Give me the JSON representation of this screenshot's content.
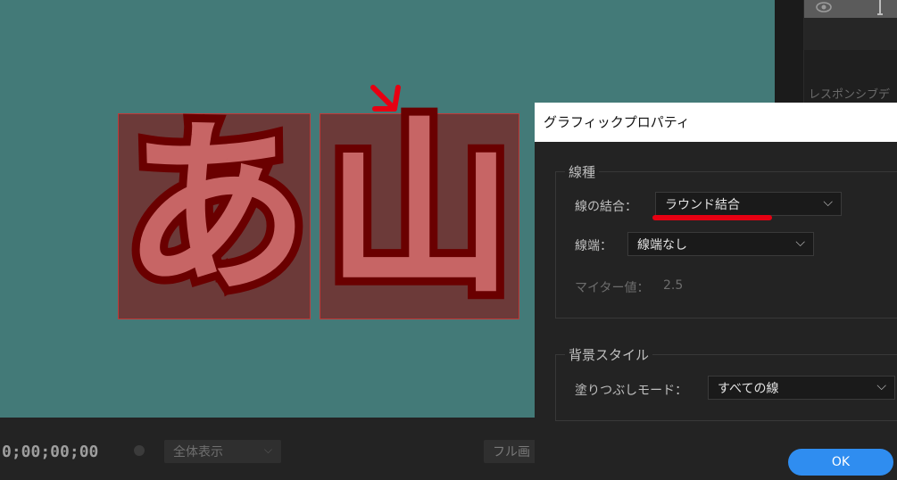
{
  "canvas": {
    "glyph_left": "あ",
    "glyph_right": "山",
    "annotation_arrow": "red-arrow-icon"
  },
  "bottom_bar": {
    "timecode": "0;00;00;00",
    "zoom_value": "全体表示",
    "full_button_label": "フル画"
  },
  "right_panel": {
    "label": "レスポンシブデ"
  },
  "dialog": {
    "title": "グラフィックプロパティ",
    "stroke_group": {
      "legend": "線種",
      "join_label": "線の結合：",
      "join_value": "ラウンド結合",
      "cap_label": "線端：",
      "cap_value": "線端なし",
      "miter_label": "マイター値：",
      "miter_value": "2.5"
    },
    "background_group": {
      "legend": "背景スタイル",
      "fill_mode_label": "塗りつぶしモード：",
      "fill_mode_value": "すべての線"
    },
    "ok_label": "OK"
  },
  "colors": {
    "canvas_bg": "#437a78",
    "dialog_bg": "#232323",
    "accent": "#2f8df0",
    "annotation": "#e60012",
    "glyph_fill": "#c76565",
    "glyph_stroke": "#6a0000"
  }
}
